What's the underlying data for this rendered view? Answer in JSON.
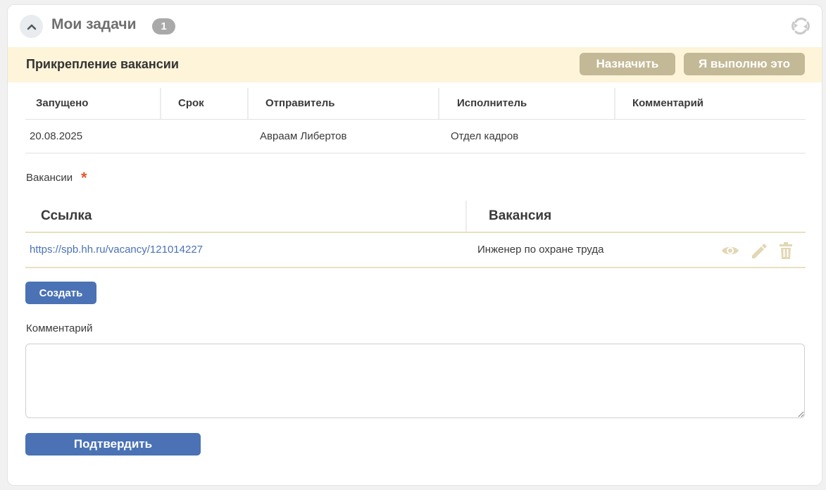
{
  "header": {
    "title": "Мои задачи",
    "count": "1",
    "icons": {
      "collapse": "chevron-up-icon",
      "refresh": "refresh-icon"
    }
  },
  "task": {
    "title": "Прикрепление вакансии",
    "assign_label": "Назначить",
    "self_label": "Я выполню это"
  },
  "info_table": {
    "columns": [
      "Запущено",
      "Срок",
      "Отправитель",
      "Исполнитель",
      "Комментарий"
    ],
    "row": {
      "started": "20.08.2025",
      "deadline": "",
      "sender": "Авраам Либертов",
      "executor": "Отдел кадров",
      "comment": ""
    }
  },
  "vacancies": {
    "label": "Вакансии",
    "required_mark": "*",
    "columns": [
      "Ссылка",
      "Вакансия"
    ],
    "rows": [
      {
        "link": "https://spb.hh.ru/vacancy/121014227",
        "name": "Инженер по охране труда",
        "actions": [
          "eye-icon",
          "pencil-icon",
          "trash-icon"
        ]
      }
    ],
    "create_label": "Создать"
  },
  "comment": {
    "label": "Комментарий",
    "value": ""
  },
  "confirm_label": "Подтвердить",
  "colors": {
    "accent_blue": "#4a72b5",
    "tan_button": "#c4b997",
    "task_bar_bg": "#fdf4d9",
    "required": "#e4572e",
    "row_icon": "#e2d7b5"
  }
}
